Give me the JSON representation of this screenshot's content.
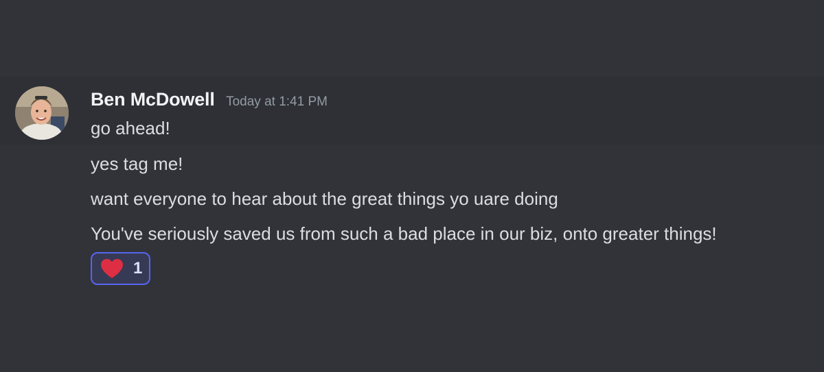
{
  "message": {
    "author": "Ben McDowell",
    "timestamp": "Today at 1:41 PM",
    "lines": [
      "go ahead!",
      "yes tag me!",
      "want everyone to hear about the great things yo uare doing",
      "You've seriously saved us from such a bad place in our biz, onto greater things!"
    ],
    "reaction": {
      "icon": "heart-icon",
      "count": "1",
      "color": "#dd2e44"
    }
  },
  "colors": {
    "background": "#313338",
    "accent": "#5865f2"
  }
}
